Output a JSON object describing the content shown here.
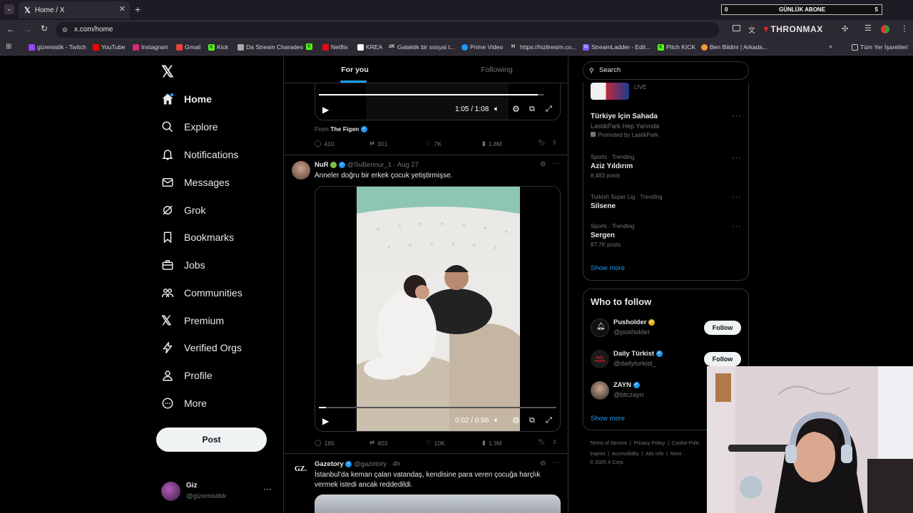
{
  "browser": {
    "tab_title": "Home / X",
    "url": "x.com/home",
    "counter": {
      "left": "0",
      "label": "GÜNLÜK ABONE",
      "right": "5"
    },
    "thronmax": "THRONMAX",
    "bookmarks": [
      "gizemistik - Twitch",
      "YouTube",
      "Instagram",
      "Gmail",
      "Kick",
      "Da Stream Charades",
      "Netflix",
      "KREA",
      "Galaktik bir sosyal t...",
      "Prime Video",
      "https://hizliresim.co...",
      "StreamLadder - Edit...",
      "Pitch KICK",
      "Ben Bildim | Arkada..."
    ],
    "all_bookmarks": "Tüm Yer İşaretleri",
    "bm_prefixes": [
      "K",
      "K",
      "zK",
      "H",
      "SL",
      "K"
    ]
  },
  "nav": {
    "items": [
      "Home",
      "Explore",
      "Notifications",
      "Messages",
      "Grok",
      "Bookmarks",
      "Jobs",
      "Communities",
      "Premium",
      "Verified Orgs",
      "Profile",
      "More"
    ],
    "post": "Post",
    "user": {
      "name": "Giz",
      "handle": "@gizemistikk"
    }
  },
  "feed": {
    "tabs": [
      "For you",
      "Following"
    ],
    "post1": {
      "time": "1:05 / 1:08",
      "from_label": "From",
      "from_name": "The Figen",
      "replies": "410",
      "reposts": "301",
      "likes": "7K",
      "views": "1.8M"
    },
    "post2": {
      "name": "NuR",
      "handle": "@SuBennur_1",
      "date": "· Aug 27",
      "text": "Anneler doğru bir erkek çocuk yetiştirmişse.",
      "time": "0:02 / 0:56",
      "replies": "185",
      "reposts": "403",
      "likes": "10K",
      "views": "1.3M",
      "progress": 0.03
    },
    "post3": {
      "avatar_text": "GZ.",
      "name": "Gazetory",
      "handle": "@gazetory",
      "date": "· 4h",
      "text": "İstanbul'da keman çalan vatandaş, kendisine para veren çocuğa harçlık vermek istedi ancak reddedildi."
    }
  },
  "right": {
    "search_placeholder": "Search",
    "live": "LIVE",
    "promo": {
      "title": "Türkiye İçin Sahada",
      "sub": "LastikPark Hep Yanında",
      "promoted": "Promoted by LastikPark"
    },
    "trends": [
      {
        "context": "Sports · Trending",
        "name": "Aziz Yıldırım",
        "posts": "8,483 posts"
      },
      {
        "context": "Turkish Super Lig · Trending",
        "name": "Silsene",
        "posts": ""
      },
      {
        "context": "Sports · Trending",
        "name": "Sergen",
        "posts": "87.7K posts"
      }
    ],
    "show_more": "Show more",
    "wtf_title": "Who to follow",
    "follow_label": "Follow",
    "accounts": [
      {
        "name": "Pusholder",
        "handle": "@pusholder"
      },
      {
        "name": "Daily Türkist",
        "handle": "@dailyturkist_"
      },
      {
        "name": "ZAYN",
        "handle": "@btczayn"
      }
    ],
    "avatar_text": "Daily Türkist",
    "footer": {
      "line1": [
        "Terms of Service",
        "Privacy Policy",
        "Cookie Polic"
      ],
      "line2": [
        "Imprint",
        "Accessibility",
        "Ads info",
        "More ·"
      ],
      "copyright": "© 2025 X Corp."
    }
  }
}
